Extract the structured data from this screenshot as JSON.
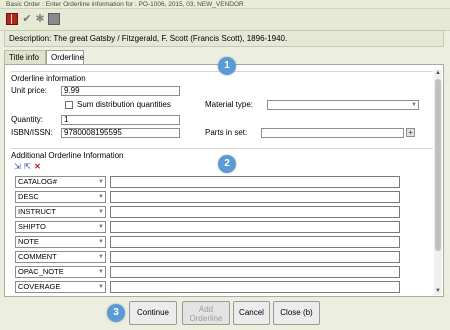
{
  "window": {
    "title": "Basic Order : Enter Orderline information for : PO-1006, 2015, 03, NEW_VENDOR"
  },
  "toolbar": {
    "icons": [
      "book-icon",
      "checkmark-icon",
      "gear-icon",
      "save-icon"
    ]
  },
  "description": {
    "text": "Description: The great Gatsby / Fitzgerald, F. Scott (Francis Scott), 1896-1940."
  },
  "tabs": [
    {
      "label": "Title info",
      "selected": false
    },
    {
      "label": "Orderline",
      "selected": true
    }
  ],
  "orderline": {
    "section_title": "Orderline information",
    "unit_price_label": "Unit price:",
    "unit_price_value": "9.99",
    "sum_distribution_label": "Sum distribution quantities",
    "sum_distribution_checked": false,
    "material_type_label": "Material type:",
    "material_type_value": "",
    "quantity_label": "Quantity:",
    "quantity_value": "1",
    "isbn_label": "ISBN/ISSN:",
    "isbn_value": "9780008195595",
    "parts_in_set_label": "Parts in set:",
    "parts_in_set_value": "",
    "plus_label": "+"
  },
  "additional": {
    "section_title": "Additional Orderline Information",
    "icons": [
      "add-row-icon",
      "insert-row-icon",
      "delete-row-icon"
    ],
    "rows": [
      {
        "code": "CATALOG#",
        "value": ""
      },
      {
        "code": "DESC",
        "value": ""
      },
      {
        "code": "INSTRUCT",
        "value": ""
      },
      {
        "code": "SHIPTO",
        "value": ""
      },
      {
        "code": "NOTE",
        "value": ""
      },
      {
        "code": "COMMENT",
        "value": ""
      },
      {
        "code": "OPAC_NOTE",
        "value": ""
      },
      {
        "code": "COVERAGE",
        "value": ""
      }
    ]
  },
  "badges": [
    "1",
    "2",
    "3"
  ],
  "buttons": {
    "continue": "Continue",
    "add_line1": "Add",
    "add_line2": "Orderline",
    "cancel": "Cancel",
    "close": "Close (b)"
  },
  "colors": {
    "badge": "#5b9bd5",
    "window_bg": "#ecefe0",
    "delete_icon": "#c02020"
  }
}
